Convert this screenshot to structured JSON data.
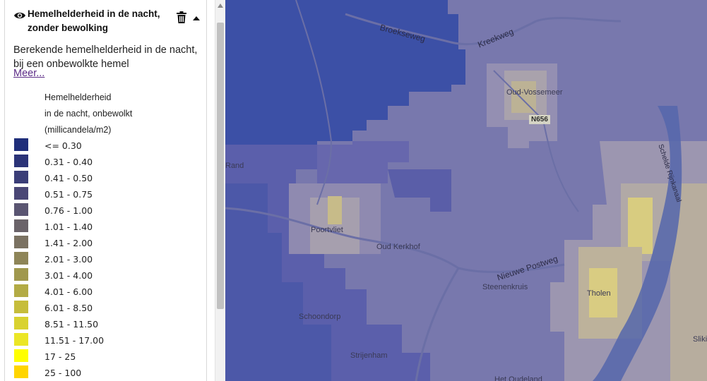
{
  "layer": {
    "title_line1": "Hemelhelderheid in de nacht,",
    "title_line2": "zonder bewolking",
    "description_line1": "Berekende hemelhelderheid in de nacht,",
    "description_line2": "bij een onbewolkte hemel",
    "more_link": "Meer..."
  },
  "legend": {
    "title_line1": "Hemelhelderheid",
    "title_line2": "in de nacht, onbewolkt",
    "title_line3": "(millicandela/m2)",
    "items": [
      {
        "label": "<= 0.30",
        "color": "#1f2e7a"
      },
      {
        "label": "0.31 - 0.40",
        "color": "#2c3478"
      },
      {
        "label": "0.41 - 0.50",
        "color": "#3b3e78"
      },
      {
        "label": "0.51 - 0.75",
        "color": "#4a4776"
      },
      {
        "label": "0.76 - 1.00",
        "color": "#5a5572"
      },
      {
        "label": "1.01 - 1.40",
        "color": "#6a6369"
      },
      {
        "label": "1.41 - 2.00",
        "color": "#7b7262"
      },
      {
        "label": "2.01 - 3.00",
        "color": "#8e8558"
      },
      {
        "label": "3.01 - 4.00",
        "color": "#a0984e"
      },
      {
        "label": "4.01 - 6.00",
        "color": "#b3ab45"
      },
      {
        "label": "6.01 - 8.50",
        "color": "#c6bd3b"
      },
      {
        "label": "8.51 - 11.50",
        "color": "#d9d230"
      },
      {
        "label": "11.51 - 17.00",
        "color": "#ebe626"
      },
      {
        "label": "17 - 25",
        "color": "#ffff00"
      },
      {
        "label": "25 - 100",
        "color": "#ffd500"
      }
    ]
  },
  "map": {
    "places": {
      "oud_vossemeer": "Oud-Vossemeer",
      "poortvliet": "Poortvliet",
      "oud_kerkhof": "Oud Kerkhof",
      "steenenkruis": "Steenenkruis",
      "tholen": "Tholen",
      "schoondorp": "Schoondorp",
      "strijenham": "Strijenham",
      "rand": "Rand",
      "het_oudeland": "Het Oudeland",
      "sliki": "Sliki"
    },
    "roads": {
      "broekseweg": "Broekseweg",
      "kreekweg": "Kreekweg",
      "nieuwe_postweg": "Nieuwe Postweg",
      "schelde_rijnkanaal": "Schelde Rijnkanaal",
      "n656": "N656"
    }
  }
}
